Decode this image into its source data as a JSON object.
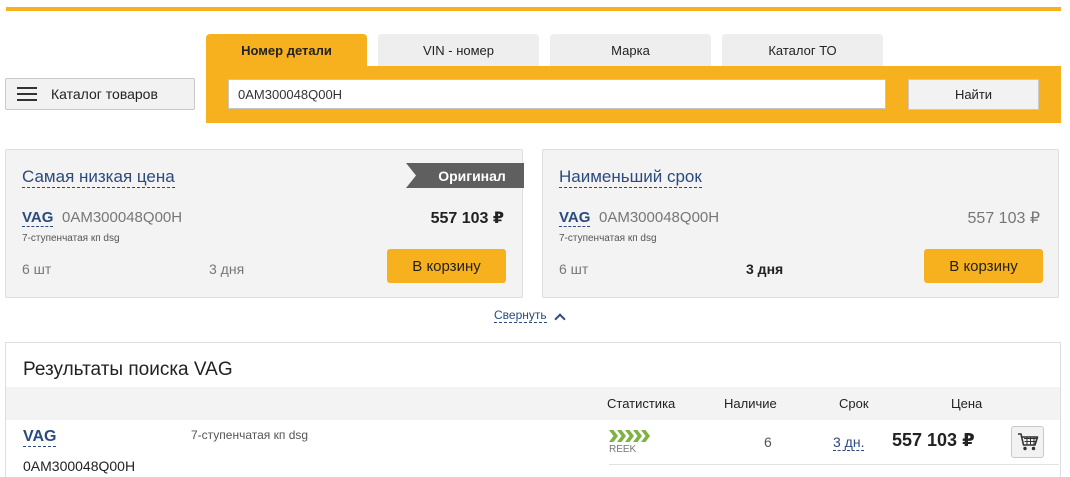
{
  "catalog_button": {
    "label": "Каталог товаров"
  },
  "search": {
    "tabs": [
      {
        "label": "Номер детали",
        "active": true
      },
      {
        "label": "VIN - номер",
        "active": false
      },
      {
        "label": "Марка",
        "active": false
      },
      {
        "label": "Каталог ТО",
        "active": false
      }
    ],
    "value": "0AM300048Q00H",
    "button_label": "Найти"
  },
  "offers": {
    "lowest_price": {
      "title": "Самая низкая цена",
      "badge": "Оригинал",
      "brand": "VAG",
      "part_number": "0AM300048Q00H",
      "description": "7-ступенчатая кп dsg",
      "price": "557 103 ₽",
      "quantity": "6 шт",
      "delivery": "3 дня",
      "cart_label": "В корзину"
    },
    "shortest_term": {
      "title": "Наименьший срок",
      "brand": "VAG",
      "part_number": "0AM300048Q00H",
      "description": "7-ступенчатая кп dsg",
      "price": "557 103 ₽",
      "quantity": "6 шт",
      "delivery": "3 дня",
      "cart_label": "В корзину"
    }
  },
  "collapse_label": "Свернуть",
  "results": {
    "title": "Результаты поиска VAG",
    "columns": {
      "statistics": "Статистика",
      "availability": "Наличие",
      "term": "Срок",
      "price": "Цена"
    },
    "rows": [
      {
        "brand": "VAG",
        "part_number": "0AM300048Q00H",
        "description": "7-ступенчатая кп dsg",
        "stat_source": "REEK",
        "availability": "6",
        "term": "3 дн.",
        "price": "557 103 ₽"
      }
    ]
  },
  "colors": {
    "accent": "#f7b11f",
    "link": "#2b4a7e",
    "badge": "#5f5f5f",
    "stat_green": "#7cb342"
  },
  "icons": {
    "menu": "hamburger-icon",
    "collapse": "chevron-up-icon",
    "cart": "shopping-cart-icon",
    "stats": "chevron-arrows-icon"
  }
}
